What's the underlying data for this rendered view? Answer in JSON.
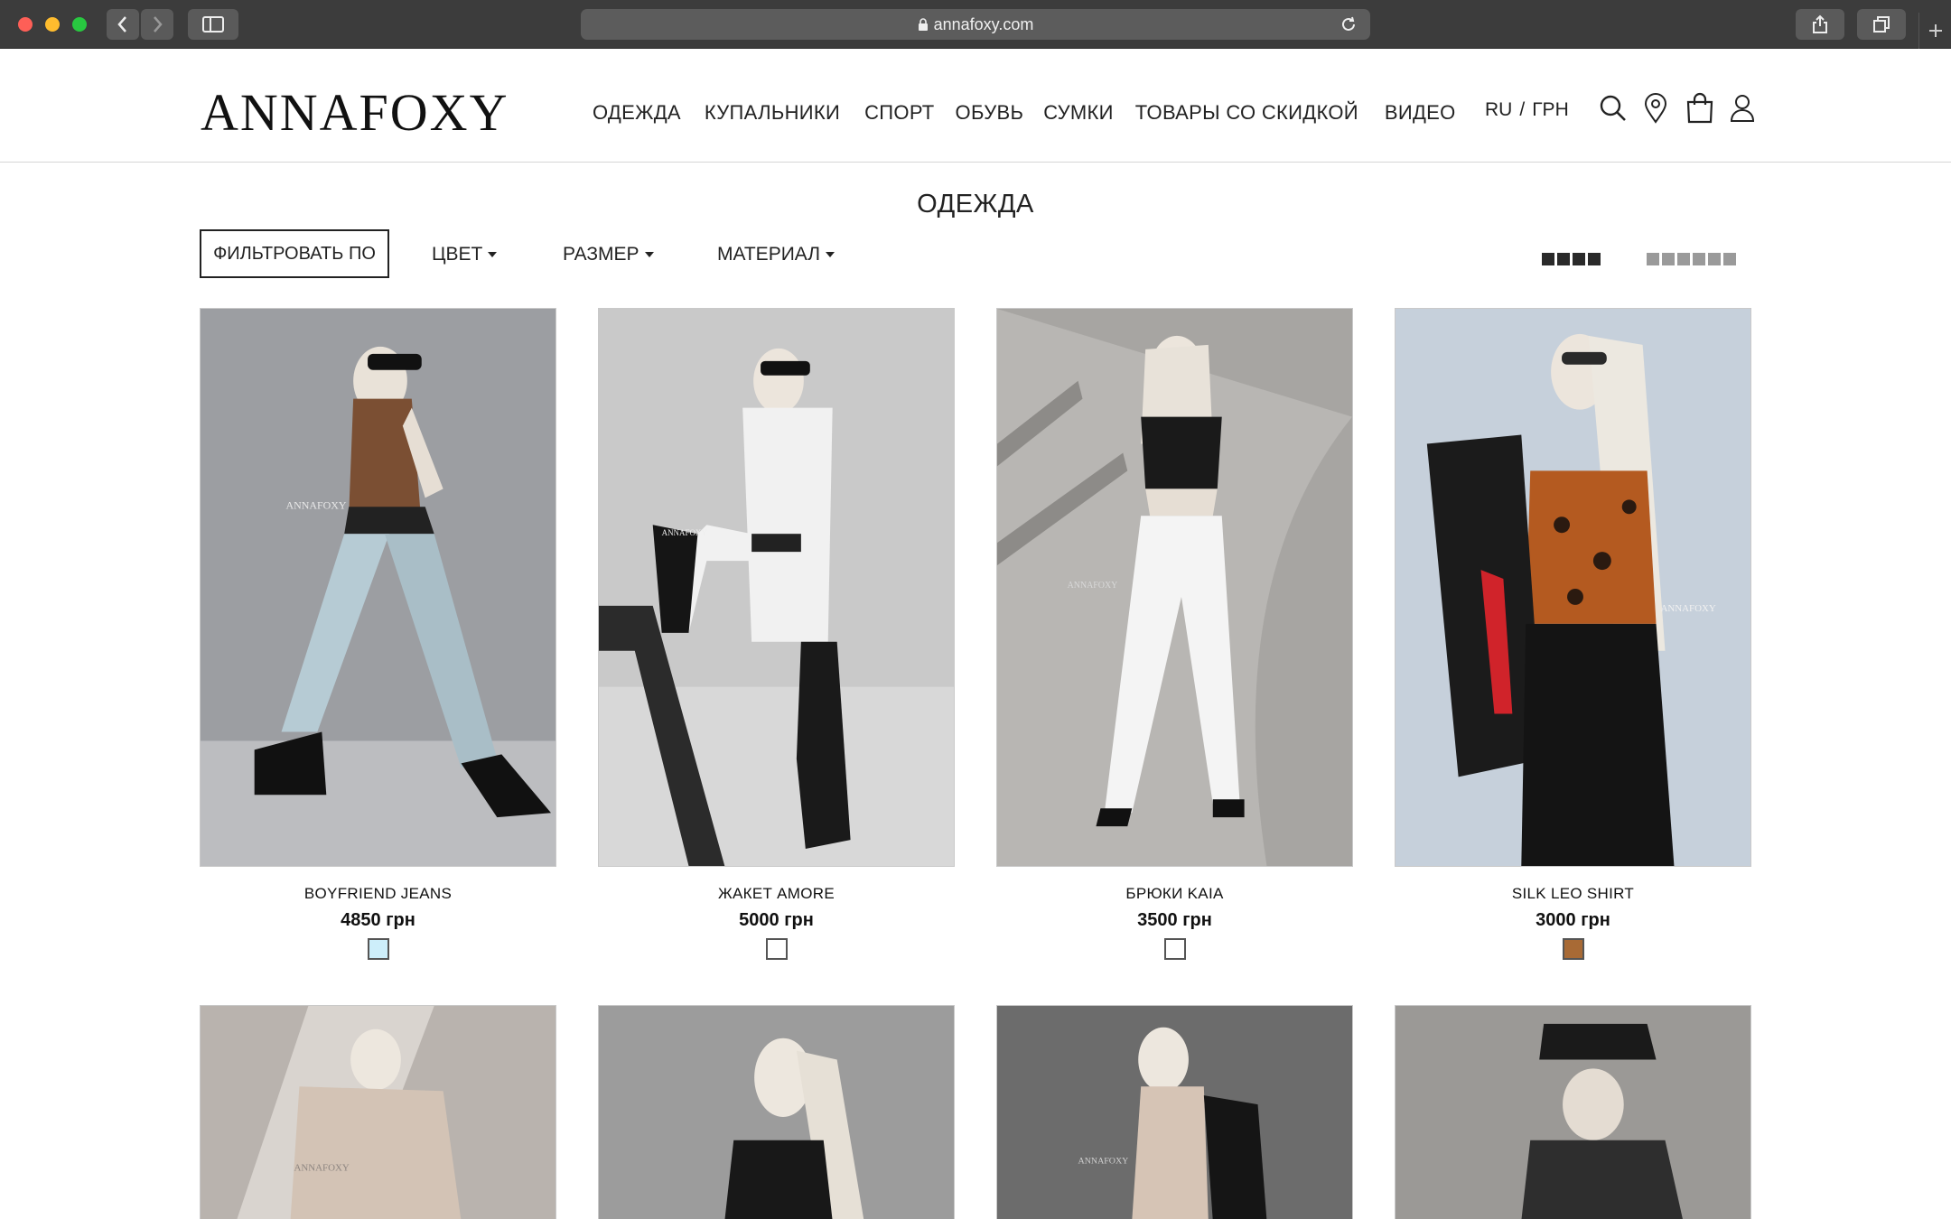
{
  "browser": {
    "url": "annafoxy.com"
  },
  "header": {
    "logo": "ANNAFOXY",
    "nav": [
      "ОДЕЖДА",
      "КУПАЛЬНИКИ",
      "СПОРТ",
      "ОБУВЬ",
      "СУМКИ",
      "ТОВАРЫ СО СКИДКОЙ",
      "ВИДЕО"
    ],
    "lang": "RU",
    "separator": "/",
    "currency": "ГРН"
  },
  "page": {
    "title": "ОДЕЖДА"
  },
  "filters": {
    "filter_button": "ФИЛЬТРОВАТЬ ПО",
    "color": "ЦВЕТ",
    "size": "РАЗМЕР",
    "material": "МАТЕРИАЛ"
  },
  "products": [
    {
      "name": "BOYFRIEND JEANS",
      "price": "4850 грн",
      "swatch_color": "#cdeefa"
    },
    {
      "name": "ЖАКЕТ AMORE",
      "price": "5000 грн",
      "swatch_color": "#ffffff"
    },
    {
      "name": "БРЮКИ KAIA",
      "price": "3500 грн",
      "swatch_color": "#ffffff"
    },
    {
      "name": "SILK LEO SHIRT",
      "price": "3000 грн",
      "swatch_color": "#a86a35"
    }
  ],
  "photo_watermark": "ANNAFOXY",
  "colors": {
    "chrome": "#3c3c3c",
    "text": "#222222"
  }
}
